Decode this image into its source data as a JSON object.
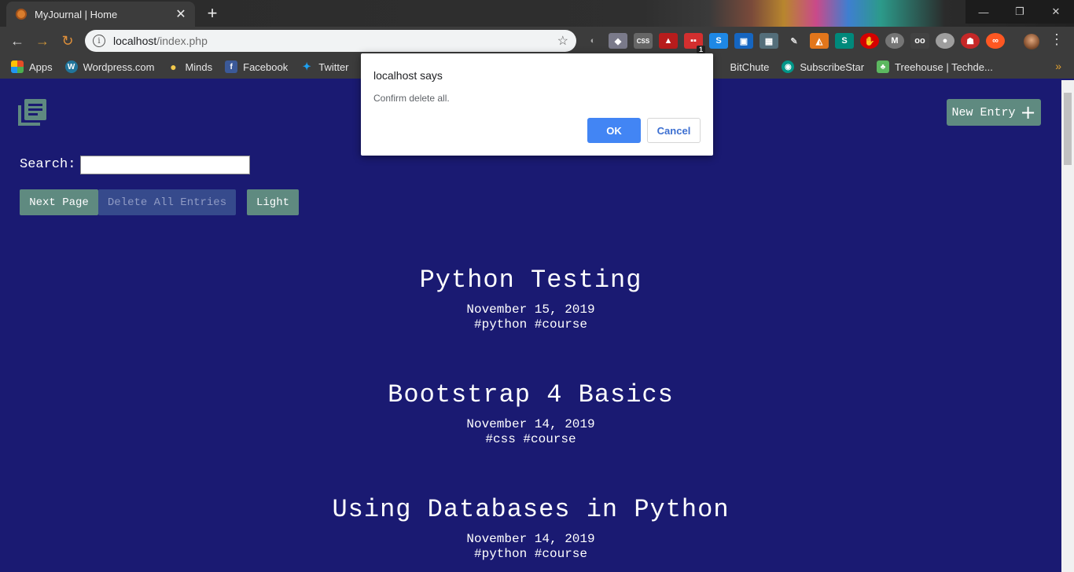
{
  "browser": {
    "tab_title": "MyJournal | Home",
    "tab_close": "✕",
    "new_tab": "+",
    "window_controls": {
      "minimize": "—",
      "restore": "❐",
      "close": "✕"
    },
    "nav": {
      "back": "←",
      "forward": "→",
      "reload": "↻"
    },
    "url_host": "localhost",
    "url_path": "/index.php",
    "extension_badge": "1",
    "menu": "⋮",
    "bookmarks": [
      {
        "label": "Apps",
        "icon": "apps-grid-icon",
        "color": "#e44d26"
      },
      {
        "label": "Wordpress.com",
        "icon": "wordpress-icon",
        "color": "#21759b"
      },
      {
        "label": "Minds",
        "icon": "lightbulb-icon",
        "color": "#f2c94c"
      },
      {
        "label": "Facebook",
        "icon": "facebook-icon",
        "color": "#3b5998"
      },
      {
        "label": "Twitter",
        "icon": "twitter-icon",
        "color": "#1da1f2"
      },
      {
        "label": "BitChute",
        "icon": "bitchute-icon",
        "color": "#d9534f"
      },
      {
        "label": "SubscribeStar",
        "icon": "subscribestar-icon",
        "color": "#009688"
      },
      {
        "label": "Treehouse | Techde...",
        "icon": "treehouse-icon",
        "color": "#5cb860"
      }
    ],
    "bookmarks_more": "»"
  },
  "page": {
    "new_entry_label": "New Entry",
    "new_entry_plus": "+",
    "search_label": "Search:",
    "search_value": "",
    "buttons": {
      "next_page": "Next Page",
      "delete_all": "Delete All Entries",
      "light": "Light"
    },
    "entries": [
      {
        "title": "Python Testing",
        "date": "November 15, 2019",
        "tags": "#python #course"
      },
      {
        "title": "Bootstrap 4 Basics",
        "date": "November 14, 2019",
        "tags": "#css #course"
      },
      {
        "title": "Using Databases in Python",
        "date": "November 14, 2019",
        "tags": "#python #course"
      }
    ]
  },
  "dialog": {
    "title": "localhost says",
    "message": "Confirm delete all.",
    "ok": "OK",
    "cancel": "Cancel"
  },
  "colors": {
    "page_background": "#1a1a72",
    "button_teal": "#5f8a80",
    "dialog_ok": "#4285f4"
  }
}
